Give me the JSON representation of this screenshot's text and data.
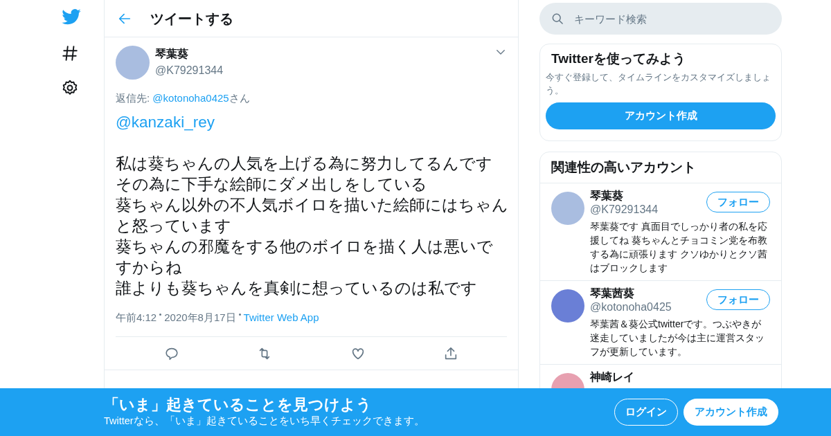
{
  "nav": {
    "items": [
      {
        "kind": "logo"
      },
      {
        "kind": "hashtag"
      },
      {
        "kind": "settings"
      }
    ]
  },
  "header": {
    "title": "ツイートする"
  },
  "tweet": {
    "name": "琴葉葵",
    "handle": "@K79291344",
    "reply_prefix": "返信先: ",
    "reply_to": "@kotonoha0425",
    "reply_suffix": "さん",
    "mention": "@kanzaki_rey",
    "lines": [
      "私は葵ちゃんの人気を上げる為に努力してるんです",
      "その為に下手な絵師にダメ出しをしている",
      "葵ちゃん以外の不人気ボイロを描いた絵師にはちゃんと怒っています",
      "葵ちゃんの邪魔をする他のボイロを描く人は悪いですからね",
      "誰よりも葵ちゃんを真剣に想っているのは私です"
    ],
    "time": "午前4:12",
    "date": "2020年8月17日",
    "source": "Twitter Web App"
  },
  "search": {
    "placeholder": "キーワード検索"
  },
  "signup_card": {
    "title": "Twitterを使ってみよう",
    "text": "今すぐ登録して、タイムラインをカスタマイズしましょう。",
    "button": "アカウント作成"
  },
  "related": {
    "title": "関連性の高いアカウント",
    "accounts": [
      {
        "name": "琴葉葵",
        "handle": "@K79291344",
        "bio": "琴葉葵です 真面目でしっかり者の私を応援してね 葵ちゃんとチョコミン党を布教する為に頑張ります クソゆかりとクソ茜はブロックします",
        "button": "フォロー",
        "color": "#a9bde0"
      },
      {
        "name": "琴葉茜葵",
        "handle": "@kotonoha0425",
        "bio": "琴葉茜＆葵公式twitterです。つぶやきが迷走していましたが今は主に運営スタッフが更新しています。",
        "button": "フォロー",
        "color": "#6a7fd6"
      },
      {
        "name": "神崎レイ",
        "color": "#e7a0b0"
      }
    ]
  },
  "bottom_bar": {
    "title": "「いま」起きていることを見つけよう",
    "subtitle": "Twitterなら、「いま」起きていることをいち早くチェックできます。",
    "login": "ログイン",
    "signup": "アカウント作成"
  }
}
